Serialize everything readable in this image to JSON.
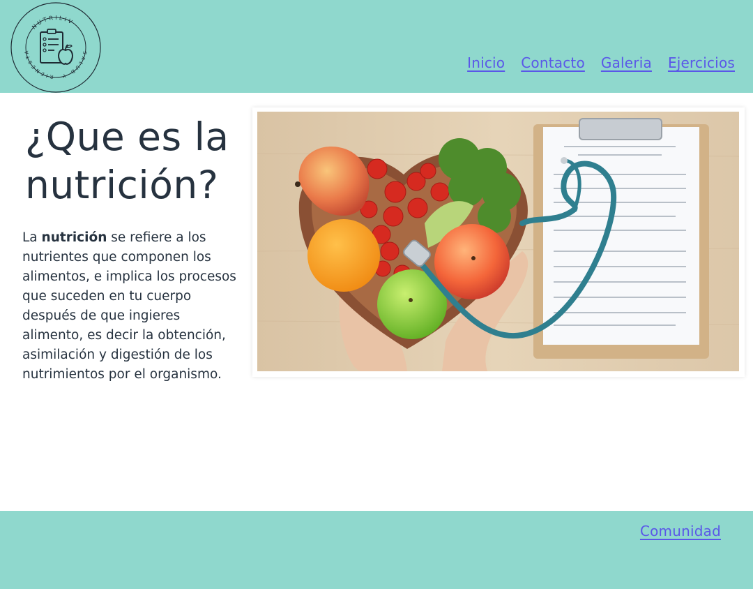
{
  "brand": {
    "ring_top": "NUTRILIV",
    "ring_left": "RIENESTAR",
    "ring_right": "SALUD Y"
  },
  "nav": {
    "items": [
      "Inicio",
      "Contacto",
      "Galeria",
      "Ejercicios"
    ]
  },
  "main": {
    "title": "¿Que es la nutrición?",
    "desc_prefix": "La ",
    "desc_bold": "nutrición",
    "desc_rest": " se refiere a los nutrientes que componen los alimentos, e implica los procesos que suceden en tu cuerpo después de que ingieres alimento, es decir la obtención, asimilación y digestión de los nutrimientos por el organismo."
  },
  "footer": {
    "link": "Comunidad"
  },
  "colors": {
    "header_bg": "#8fd8cd",
    "link": "#5a57e8",
    "text": "#26323f"
  },
  "icons": {
    "logo": "clipboard-apple-icon"
  }
}
